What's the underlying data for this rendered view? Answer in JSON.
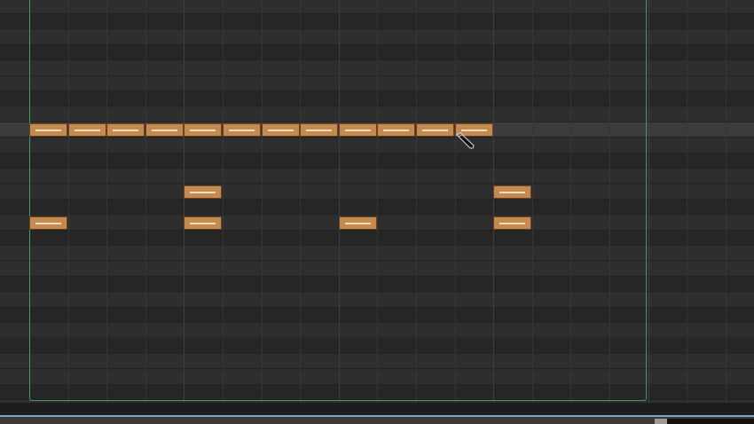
{
  "editor": {
    "tool": "pencil",
    "cursor_icon": "pencil-cursor-icon"
  },
  "colors": {
    "note_fill": "#c58a4f",
    "note_border": "#6a4220",
    "loop_border": "#3aa05a",
    "scrollbar_accent": "#7fa7c6"
  }
}
